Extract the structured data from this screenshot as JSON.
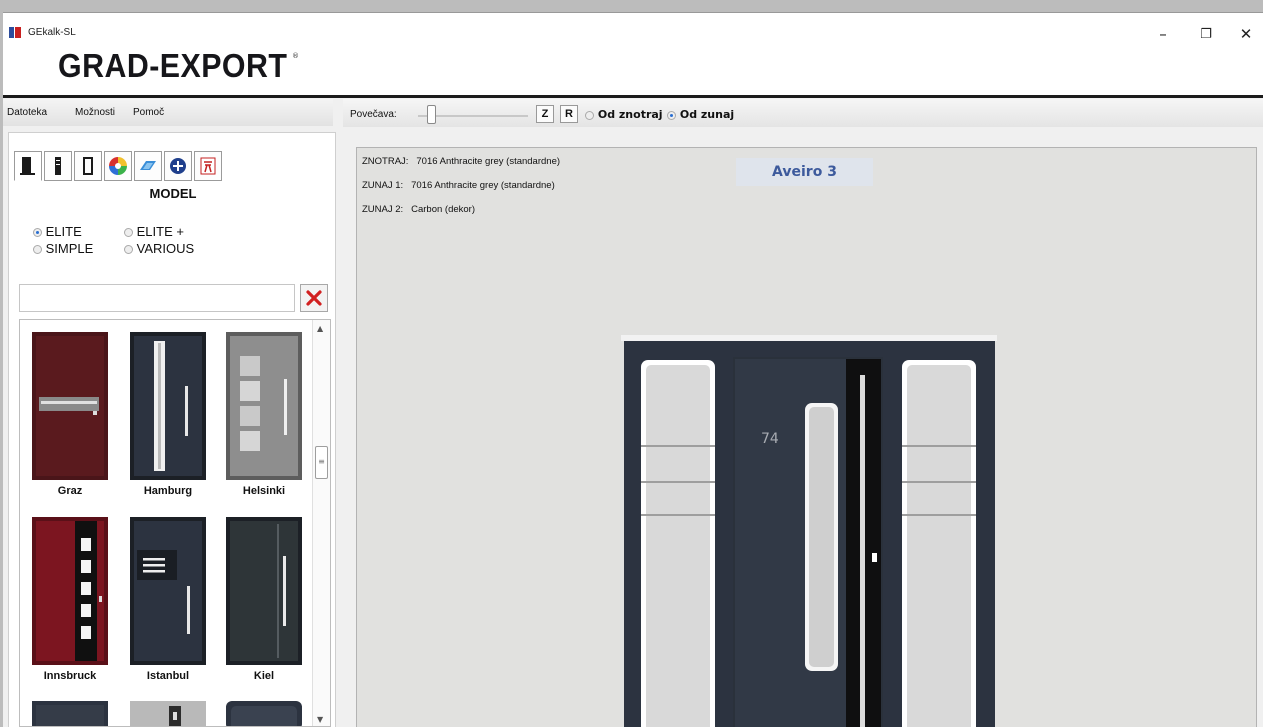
{
  "window": {
    "title": "GEkalk-SL",
    "logo_text": "GRAD-EXPORT",
    "logo_mark": "®",
    "controls": {
      "minimize": "–",
      "restore": "❐",
      "close": "✕"
    }
  },
  "menu": {
    "items": [
      "Datoteka",
      "Možnosti",
      "Pomoč"
    ]
  },
  "toolbar": {
    "zoom_label": "Povečava:",
    "zoom_level": 0.12,
    "btn_z": "Z",
    "btn_r": "R",
    "view_inside": "Od znotraj",
    "view_outside": "Od zunaj",
    "selected_view": "Od zunaj"
  },
  "tabs": [
    "door-icon",
    "panel-icon",
    "frame-icon",
    "color-wheel-icon",
    "glass-icon",
    "plus-circle-icon",
    "catalog-icon"
  ],
  "model_panel": {
    "title": "MODEL",
    "options": [
      "ELITE",
      "ELITE +",
      "SIMPLE",
      "VARIOUS"
    ],
    "selected": "ELITE",
    "search_value": "",
    "search_placeholder": ""
  },
  "gallery": {
    "items": [
      "Graz",
      "Hamburg",
      "Helsinki",
      "Innsbruck",
      "Istanbul",
      "Kiel"
    ]
  },
  "preview": {
    "inside_label": "ZNOTRAJ:",
    "inside_value": "7016 Anthracite grey (standardne)",
    "outside1_label": "ZUNAJ 1:",
    "outside1_value": "7016 Anthracite grey (standardne)",
    "outside2_label": "ZUNAJ 2:",
    "outside2_value": "Carbon (dekor)",
    "model_name": "Aveiro 3",
    "house_number": "74"
  },
  "colors": {
    "anthracite": "#2c3340",
    "graz_red": "#5a1a1e",
    "innsbruck_red": "#7c1520",
    "accent_blue": "#3d5a9c",
    "clear_red": "#d22020"
  }
}
